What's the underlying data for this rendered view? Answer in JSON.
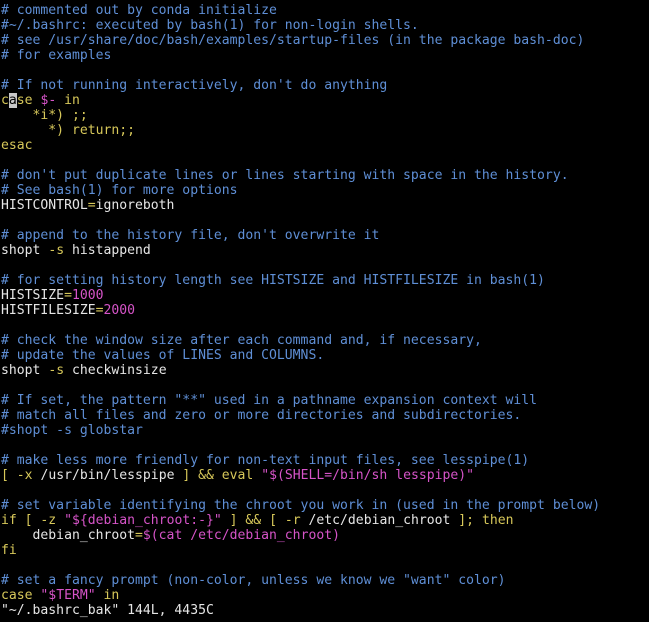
{
  "editor": {
    "theme": {
      "background": "#000000",
      "default": "#e6e6e6",
      "comment": "#5f8fd6",
      "keyword": "#d7c85a",
      "variable": "#d654c8",
      "string": "#d654c8",
      "number": "#d654c8",
      "cursor": "#c8c8c8"
    },
    "lines": [
      [
        {
          "t": "# commented out by conda initialize",
          "k": "comment"
        }
      ],
      [
        {
          "t": "#~/.bashrc: executed by bash(1) for non-login shells.",
          "k": "comment"
        }
      ],
      [
        {
          "t": "# see /usr/share/doc/bash/examples/startup-files (in the package bash-doc)",
          "k": "comment"
        }
      ],
      [
        {
          "t": "# for examples",
          "k": "comment"
        }
      ],
      [],
      [
        {
          "t": "# If not running interactively, don't do anything",
          "k": "comment"
        }
      ],
      [
        {
          "t": "c",
          "k": "keyword"
        },
        {
          "t": "a",
          "k": "cursor"
        },
        {
          "t": "se",
          "k": "keyword"
        },
        {
          "t": " ",
          "k": "text"
        },
        {
          "t": "$-",
          "k": "var"
        },
        {
          "t": " ",
          "k": "text"
        },
        {
          "t": "in",
          "k": "keyword"
        }
      ],
      [
        {
          "t": "    *i*) ;;",
          "k": "keyword"
        }
      ],
      [
        {
          "t": "      *) return;;",
          "k": "keyword"
        }
      ],
      [
        {
          "t": "esac",
          "k": "keyword"
        }
      ],
      [],
      [
        {
          "t": "# don't put duplicate lines or lines starting with space in the history.",
          "k": "comment"
        }
      ],
      [
        {
          "t": "# See bash(1) for more options",
          "k": "comment"
        }
      ],
      [
        {
          "t": "HISTCONTROL",
          "k": "text"
        },
        {
          "t": "=",
          "k": "keyword"
        },
        {
          "t": "ignoreboth",
          "k": "text"
        }
      ],
      [],
      [
        {
          "t": "# append to the history file, don't overwrite it",
          "k": "comment"
        }
      ],
      [
        {
          "t": "shopt ",
          "k": "text"
        },
        {
          "t": "-s",
          "k": "keyword"
        },
        {
          "t": " histappend",
          "k": "text"
        }
      ],
      [],
      [
        {
          "t": "# for setting history length see HISTSIZE and HISTFILESIZE in bash(1)",
          "k": "comment"
        }
      ],
      [
        {
          "t": "HISTSIZE",
          "k": "text"
        },
        {
          "t": "=",
          "k": "keyword"
        },
        {
          "t": "1000",
          "k": "number"
        }
      ],
      [
        {
          "t": "HISTFILESIZE",
          "k": "text"
        },
        {
          "t": "=",
          "k": "keyword"
        },
        {
          "t": "2000",
          "k": "number"
        }
      ],
      [],
      [
        {
          "t": "# check the window size after each command and, if necessary,",
          "k": "comment"
        }
      ],
      [
        {
          "t": "# update the values of LINES and COLUMNS.",
          "k": "comment"
        }
      ],
      [
        {
          "t": "shopt ",
          "k": "text"
        },
        {
          "t": "-s",
          "k": "keyword"
        },
        {
          "t": " checkwinsize",
          "k": "text"
        }
      ],
      [],
      [
        {
          "t": "# If set, the pattern \"**\" used in a pathname expansion context will",
          "k": "comment"
        }
      ],
      [
        {
          "t": "# match all files and zero or more directories and subdirectories.",
          "k": "comment"
        }
      ],
      [
        {
          "t": "#shopt -s globstar",
          "k": "comment"
        }
      ],
      [],
      [
        {
          "t": "# make less more friendly for non-text input files, see lesspipe(1)",
          "k": "comment"
        }
      ],
      [
        {
          "t": "[ ",
          "k": "keyword"
        },
        {
          "t": "-x",
          "k": "keyword"
        },
        {
          "t": " /usr/bin/lesspipe ",
          "k": "text"
        },
        {
          "t": "] && eval ",
          "k": "keyword"
        },
        {
          "t": "\"$(SHELL=/bin/sh lesspipe)\"",
          "k": "string"
        }
      ],
      [],
      [
        {
          "t": "# set variable identifying the chroot you work in (used in the prompt below)",
          "k": "comment"
        }
      ],
      [
        {
          "t": "if [ ",
          "k": "keyword"
        },
        {
          "t": "-z",
          "k": "keyword"
        },
        {
          "t": " ",
          "k": "text"
        },
        {
          "t": "\"${debian_chroot:-}\"",
          "k": "string"
        },
        {
          "t": " ] && [ ",
          "k": "keyword"
        },
        {
          "t": "-r",
          "k": "keyword"
        },
        {
          "t": " /etc/debian_chroot ",
          "k": "text"
        },
        {
          "t": "]; then",
          "k": "keyword"
        }
      ],
      [
        {
          "t": "    debian_chroot",
          "k": "text"
        },
        {
          "t": "=",
          "k": "keyword"
        },
        {
          "t": "$(cat /etc/debian_chroot)",
          "k": "var"
        }
      ],
      [
        {
          "t": "fi",
          "k": "keyword"
        }
      ],
      [],
      [
        {
          "t": "# set a fancy prompt (non-color, unless we know we \"want\" color)",
          "k": "comment"
        }
      ],
      [
        {
          "t": "case ",
          "k": "keyword"
        },
        {
          "t": "\"$TERM\"",
          "k": "string"
        },
        {
          "t": " in",
          "k": "keyword"
        }
      ]
    ],
    "status_line": "\"~/.bashrc_bak\" 144L, 4435C"
  }
}
